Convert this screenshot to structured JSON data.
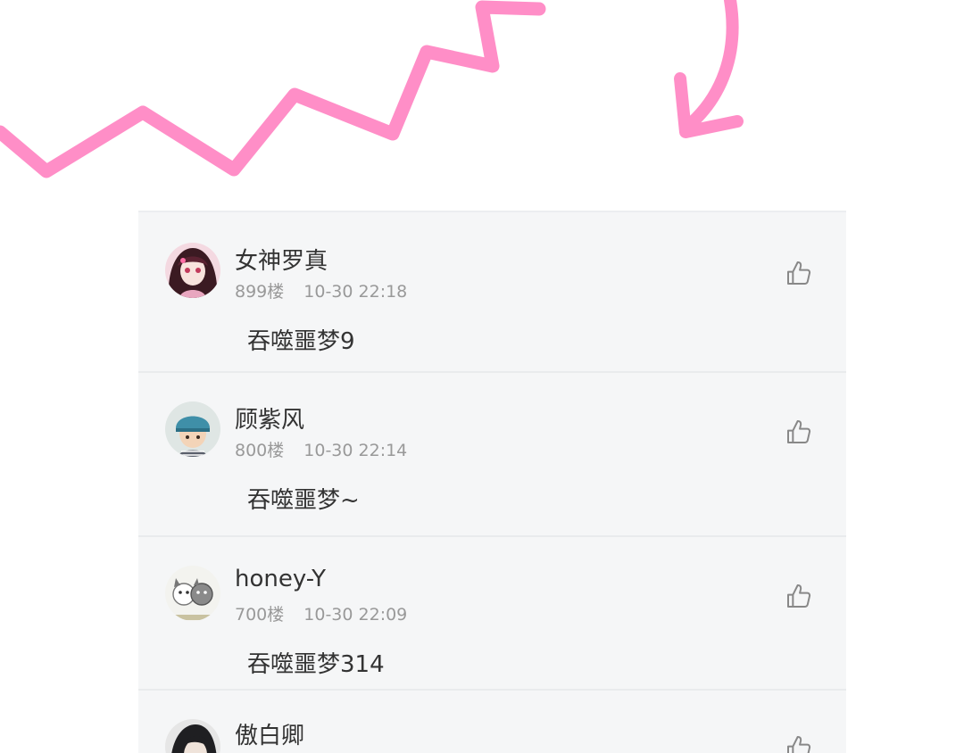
{
  "colors": {
    "doodle": "#ff8ec7",
    "list_background": "#f5f6f7",
    "divider": "#e9ebed",
    "name_text": "#333333",
    "meta_text": "#999999",
    "like_icon": "#888888"
  },
  "comments": [
    {
      "user": "女神罗真",
      "floor": "899楼",
      "time": "10-30 22:18",
      "text": "吞噬噩梦9",
      "avatar_icon": "avatar-girl-pink-hair",
      "like_icon": "thumbs-up-icon"
    },
    {
      "user": "顾紫风",
      "floor": "800楼",
      "time": "10-30 22:14",
      "text": "吞噬噩梦~",
      "avatar_icon": "avatar-child-helmet",
      "like_icon": "thumbs-up-icon"
    },
    {
      "user": "honey-Y",
      "floor": "700楼",
      "time": "10-30 22:09",
      "text": "吞噬噩梦314",
      "avatar_icon": "avatar-cartoon-animals",
      "like_icon": "thumbs-up-icon"
    },
    {
      "user": "傲白卿",
      "avatar_icon": "avatar-dark-hair",
      "like_icon": "thumbs-up-icon"
    }
  ]
}
